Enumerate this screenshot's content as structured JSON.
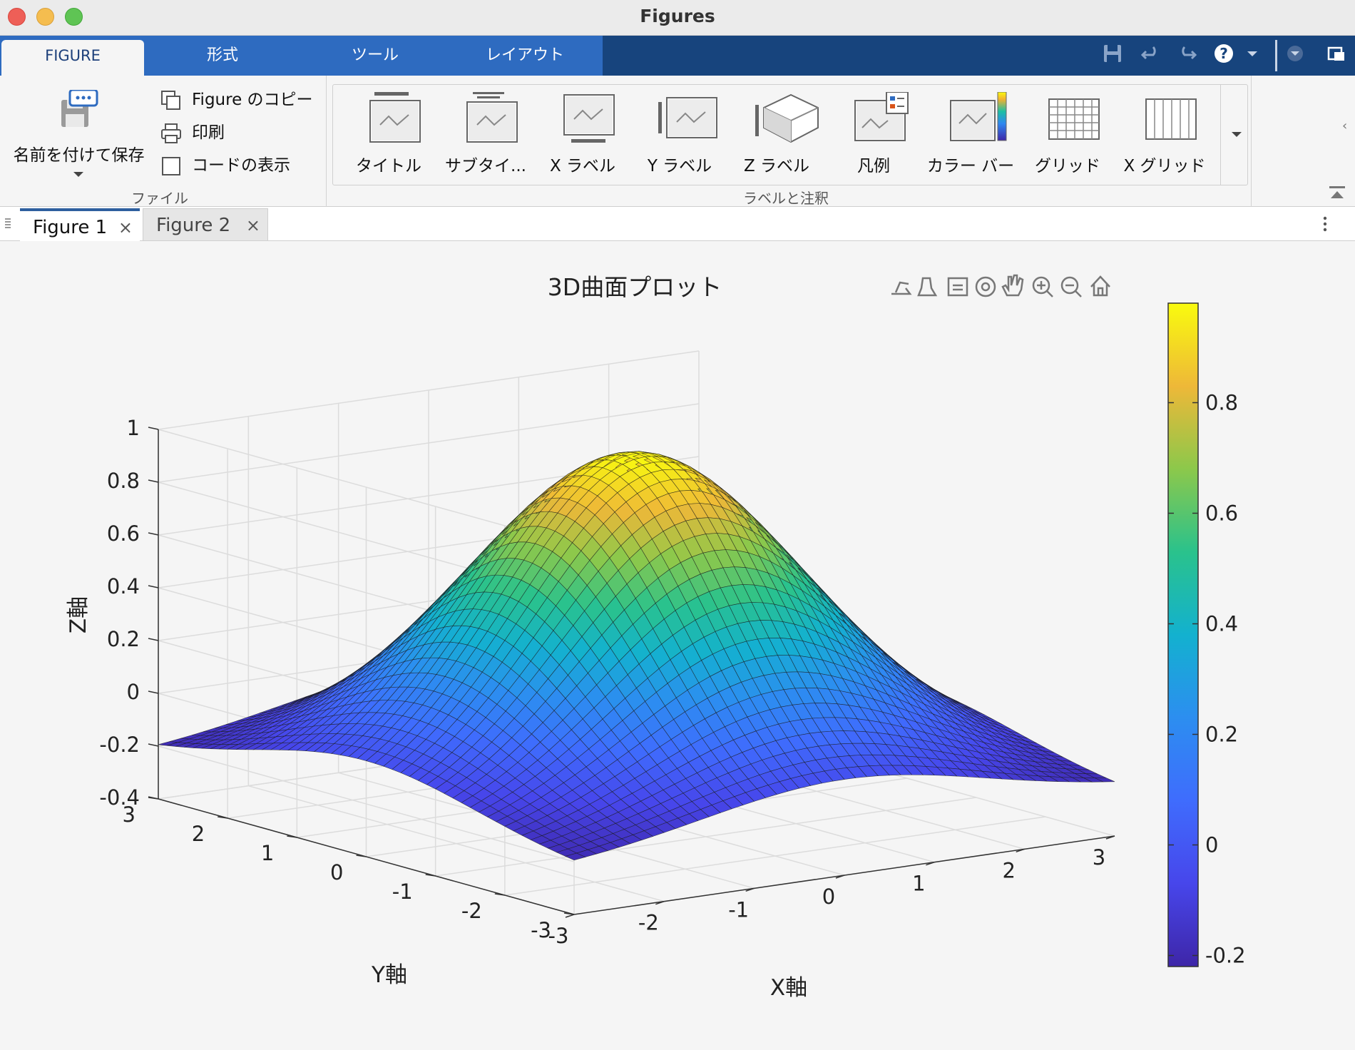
{
  "window": {
    "title": "Figures"
  },
  "ribbon_tabs": [
    "FIGURE",
    "形式",
    "ツール",
    "レイアウト"
  ],
  "file_group": {
    "save_as": "名前を付けて保存",
    "copy_figure": "Figure のコピー",
    "print": "印刷",
    "show_code": "コードの表示",
    "label": "ファイル"
  },
  "labels_group": {
    "items": [
      "タイトル",
      "サブタイ...",
      "X ラベル",
      "Y ラベル",
      "Z ラベル",
      "凡例",
      "カラー バー",
      "グリッド",
      "X グリッド"
    ],
    "label": "ラベルと注釈"
  },
  "doc_tabs": [
    {
      "label": "Figure 1",
      "close": "×"
    },
    {
      "label": "Figure 2",
      "close": "×"
    }
  ],
  "chart_data": {
    "type": "surface",
    "title": "3D曲面プロット",
    "xlabel": "X軸",
    "ylabel": "Y軸",
    "zlabel": "Z軸",
    "xlim": [
      -3,
      3
    ],
    "ylim": [
      -3,
      3
    ],
    "zlim": [
      -0.4,
      1
    ],
    "xticks": [
      "-3",
      "-2",
      "-1",
      "0",
      "1",
      "2",
      "3"
    ],
    "yticks": [
      "3",
      "2",
      "1",
      "0",
      "-1",
      "-2",
      "-3"
    ],
    "zticks": [
      "1",
      "0.8",
      "0.6",
      "0.4",
      "0.2",
      "0",
      "-0.2",
      "-0.4"
    ],
    "colorbar_ticks": [
      "0.8",
      "0.6",
      "0.4",
      "0.2",
      "0",
      "-0.2"
    ],
    "colorbar_range": [
      -0.22,
      0.98
    ],
    "colormap": "parula",
    "grid": true,
    "peak": {
      "x": 0,
      "y": 0,
      "z": 0.98
    },
    "corner_values": {
      "x_-3_y_-3": -0.22,
      "x_3_y_3": -0.22,
      "x_-3_y_3": -0.25,
      "x_3_y_-3": -0.25
    }
  }
}
